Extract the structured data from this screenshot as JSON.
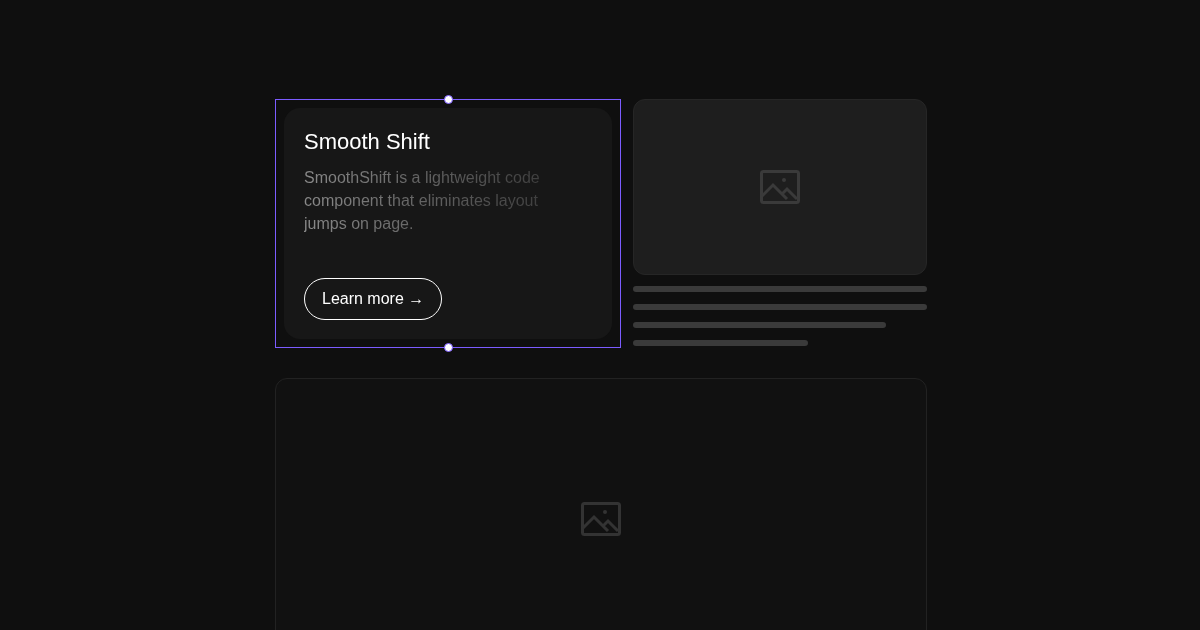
{
  "card": {
    "title": "Smooth Shift",
    "description": "SmoothShift is a lightweight code component that eliminates layout jumps on page.",
    "button": "Learn more →",
    "selected": true
  }
}
